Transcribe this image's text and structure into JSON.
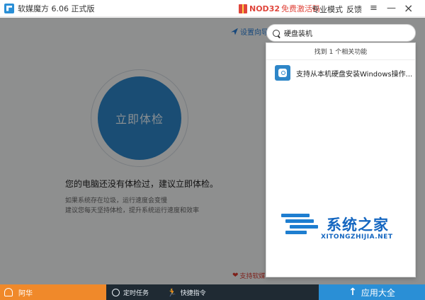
{
  "window": {
    "title": "软媒魔方 6.06 正式版",
    "promo_nod": "NOD32",
    "promo_text": "免费激活码",
    "mode_label": "专业模式",
    "feedback_label": "反馈",
    "menu_glyph": "≡",
    "minimize_glyph": "—",
    "close_glyph": "×"
  },
  "main": {
    "wizard_label": "设置向导",
    "check_button_label": "立即体检",
    "hint_main": "您的电脑还没有体检过，建议立即体检。",
    "hint_sub1": "如果系统存在垃圾，运行速度会变慢",
    "hint_sub2": "建议您每天坚持体检，提升系统运行速度和效率",
    "support_label": "支持软媒"
  },
  "search": {
    "value": "硬盘装机",
    "results_header": "找到 1 个相关功能",
    "results": [
      {
        "label": "支持从本机硬盘安装Windows操作...",
        "icon": "hdd-install-icon"
      }
    ]
  },
  "watermark": {
    "cn": "系统之家",
    "en": "XITONGZHIJIA.NET"
  },
  "bottom": {
    "user_name": "阿华",
    "timer_label": "定时任务",
    "shortcut_label": "快捷指令",
    "apps_label": "应用大全"
  },
  "colors": {
    "accent": "#2e86c8",
    "orange": "#f0892a",
    "promo_red": "#e0463c",
    "bottom_bar": "#1f2a33"
  }
}
